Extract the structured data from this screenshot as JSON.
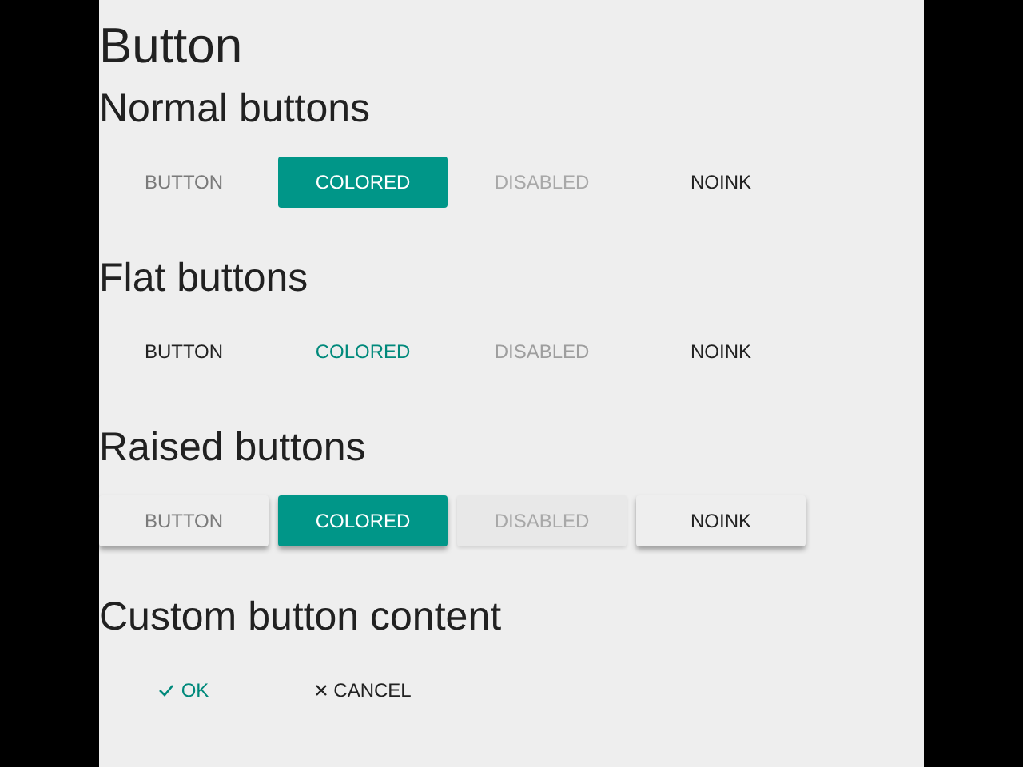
{
  "title": "Button",
  "sections": [
    {
      "heading": "Normal buttons",
      "kind": "normal",
      "buttons": [
        {
          "label": "BUTTON",
          "kind": "plain",
          "disabled": false
        },
        {
          "label": "COLORED",
          "kind": "colored",
          "disabled": false
        },
        {
          "label": "DISABLED",
          "kind": "plain",
          "disabled": true
        },
        {
          "label": "NOINK",
          "kind": "noink",
          "disabled": false
        }
      ]
    },
    {
      "heading": "Flat buttons",
      "kind": "flat",
      "buttons": [
        {
          "label": "BUTTON",
          "kind": "plain",
          "disabled": false
        },
        {
          "label": "COLORED",
          "kind": "colored",
          "disabled": false
        },
        {
          "label": "DISABLED",
          "kind": "plain",
          "disabled": true
        },
        {
          "label": "NOINK",
          "kind": "noink",
          "disabled": false
        }
      ]
    },
    {
      "heading": "Raised buttons",
      "kind": "raised",
      "buttons": [
        {
          "label": "BUTTON",
          "kind": "plain",
          "disabled": false
        },
        {
          "label": "COLORED",
          "kind": "colored",
          "disabled": false
        },
        {
          "label": "DISABLED",
          "kind": "plain",
          "disabled": true
        },
        {
          "label": "NOINK",
          "kind": "noink",
          "disabled": false
        }
      ]
    },
    {
      "heading": "Custom button content",
      "kind": "custom",
      "buttons": [
        {
          "label": "OK",
          "kind": "check",
          "disabled": false
        },
        {
          "label": "CANCEL",
          "kind": "close",
          "disabled": false
        }
      ]
    }
  ]
}
